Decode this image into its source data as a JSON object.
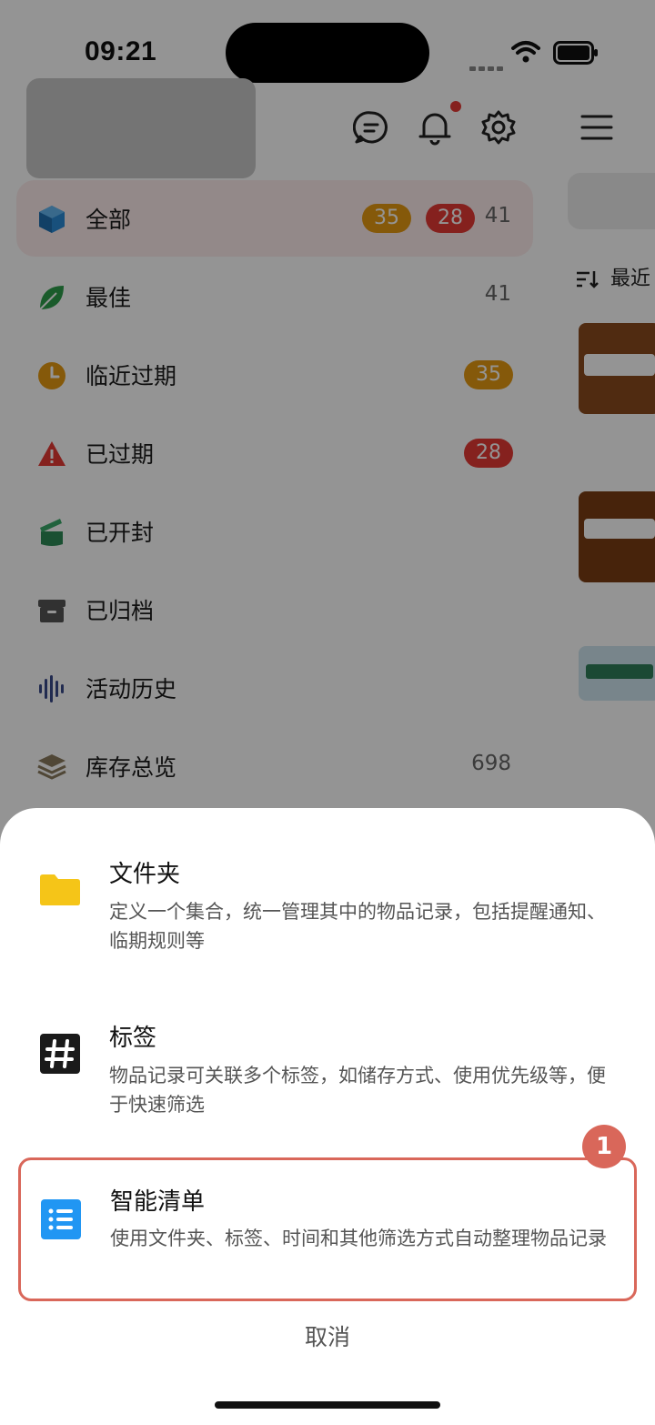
{
  "status": {
    "time": "09:21"
  },
  "sidebar": {
    "items": [
      {
        "label": "全部",
        "icon": "cube-icon",
        "badges": [
          "35",
          "28"
        ],
        "count": "41",
        "active": true
      },
      {
        "label": "最佳",
        "icon": "leaf-icon",
        "count": "41"
      },
      {
        "label": "临近过期",
        "icon": "clock-icon",
        "badges": [
          "35"
        ]
      },
      {
        "label": "已过期",
        "icon": "warning-icon",
        "badges": [
          "28"
        ]
      },
      {
        "label": "已开封",
        "icon": "open-can-icon"
      },
      {
        "label": "已归档",
        "icon": "archive-icon"
      },
      {
        "label": "活动历史",
        "icon": "waveform-icon"
      },
      {
        "label": "库存总览",
        "icon": "layers-icon",
        "count": "698"
      }
    ]
  },
  "right_panel": {
    "sort_label": "最近"
  },
  "sheet": {
    "options": [
      {
        "title": "文件夹",
        "desc": "定义一个集合，统一管理其中的物品记录，包括提醒通知、临期规则等",
        "icon": "folder-icon"
      },
      {
        "title": "标签",
        "desc": "物品记录可关联多个标签，如储存方式、使用优先级等，便于快速筛选",
        "icon": "hashtag-icon"
      },
      {
        "title": "智能清单",
        "desc": "使用文件夹、标签、时间和其他筛选方式自动整理物品记录",
        "icon": "list-icon"
      }
    ],
    "step_marker": "1",
    "cancel_label": "取消"
  },
  "colors": {
    "accent_orange": "#e69a12",
    "accent_red": "#e53935",
    "highlight": "#d9675a",
    "folder_yellow": "#f5c518",
    "list_blue": "#2196f3"
  }
}
